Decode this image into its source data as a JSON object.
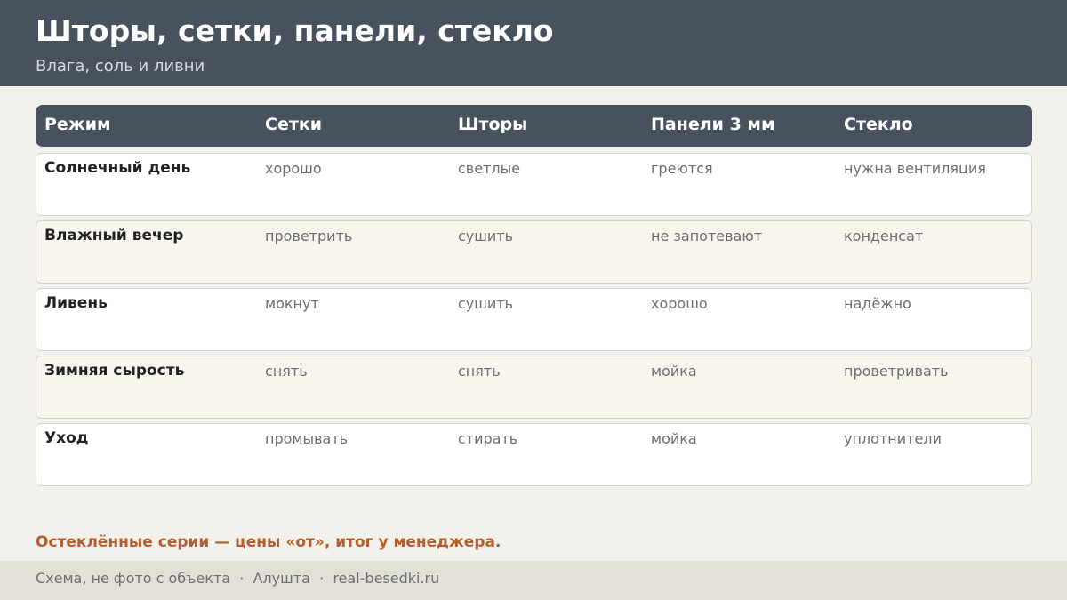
{
  "header": {
    "title": "Шторы, сетки, панели, стекло",
    "subtitle": "Влага, соль и ливни"
  },
  "table": {
    "columns": [
      "Режим",
      "Сетки",
      "Шторы",
      "Панели 3 мм",
      "Стекло"
    ],
    "rows": [
      [
        "Солнечный день",
        "хорошо",
        "светлые",
        "греются",
        "нужна вентиляция"
      ],
      [
        "Влажный вечер",
        "проветрить",
        "сушить",
        "не запотевают",
        "конденсат"
      ],
      [
        "Ливень",
        "мокнут",
        "сушить",
        "хорошо",
        "надёжно"
      ],
      [
        "Зимняя сырость",
        "снять",
        "снять",
        "мойка",
        "проветривать"
      ],
      [
        "Уход",
        "промывать",
        "стирать",
        "мойка",
        "уплотнители"
      ]
    ]
  },
  "note": "Остеклённые серии — цены «от», итог у менеджера.",
  "footer": {
    "text": "Схема, не фото с объекта  ·  Алушта  ·  real-besedki.ru"
  },
  "colors": {
    "header_bg": "#48515e",
    "accent": "#b65d2e",
    "page_bg": "#f3f1ec",
    "footer_bg": "#e3e0da"
  }
}
